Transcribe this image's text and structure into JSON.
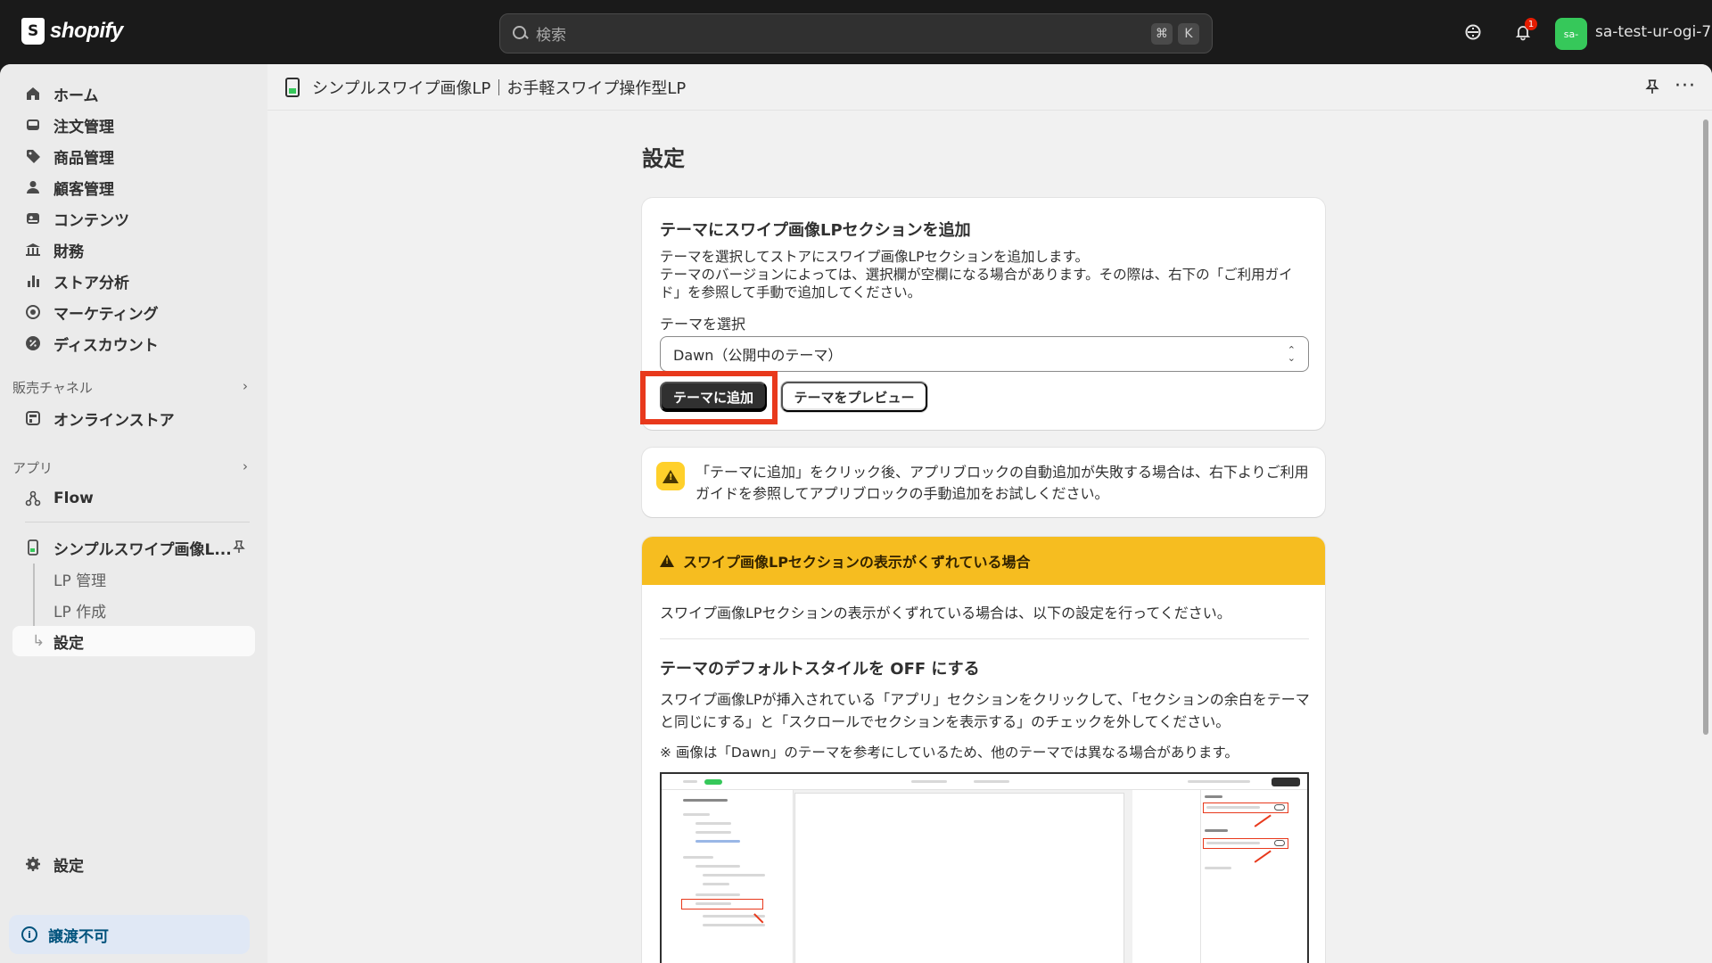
{
  "topbar": {
    "logo_text": "shopify",
    "search_placeholder": "検索",
    "shortcut_keys": [
      "⌘",
      "K"
    ],
    "notification_count": "1",
    "avatar_initials": "sa-",
    "store_name": "sa-test-ur-ogi-7"
  },
  "sidebar": {
    "items": [
      {
        "label": "ホーム",
        "icon": "home-icon"
      },
      {
        "label": "注文管理",
        "icon": "inbox-icon"
      },
      {
        "label": "商品管理",
        "icon": "tag-icon"
      },
      {
        "label": "顧客管理",
        "icon": "person-icon"
      },
      {
        "label": "コンテンツ",
        "icon": "content-icon"
      },
      {
        "label": "財務",
        "icon": "bank-icon"
      },
      {
        "label": "ストア分析",
        "icon": "chart-icon"
      },
      {
        "label": "マーケティング",
        "icon": "target-icon"
      },
      {
        "label": "ディスカウント",
        "icon": "discount-icon"
      }
    ],
    "sales_channels_label": "販売チャネル",
    "online_store_label": "オンラインストア",
    "apps_label": "アプリ",
    "flow_label": "Flow",
    "app_name": "シンプルスワイプ画像L...",
    "app_sub_items": [
      "LP 管理",
      "LP 作成",
      "設定"
    ],
    "settings_label": "設定",
    "notice_label": "譲渡不可"
  },
  "main": {
    "app_header_title": "シンプルスワイプ画像LP｜お手軽スワイプ操作型LP",
    "page_title": "設定",
    "card1": {
      "heading": "テーマにスワイプ画像LPセクションを追加",
      "desc_line1": "テーマを選択してストアにスワイプ画像LPセクションを追加します。",
      "desc_line2": "テーマのバージョンによっては、選択欄が空欄になる場合があります。その際は、右下の「ご利用ガイド」を参照して手動で追加してください。",
      "select_label": "テーマを選択",
      "select_value": "Dawn（公開中のテーマ）",
      "primary_button": "テーマに追加",
      "secondary_button": "テーマをプレビュー"
    },
    "card2": {
      "message": "「テーマに追加」をクリック後、アプリブロックの自動追加が失敗する場合は、右下よりご利用ガイドを参照してアプリブロックの手動追加をお試しください。"
    },
    "card3": {
      "header": "スワイプ画像LPセクションの表示がくずれている場合",
      "intro": "スワイプ画像LPセクションの表示がくずれている場合は、以下の設定を行ってください。",
      "subheading": "テーマのデフォルトスタイルを OFF にする",
      "paragraph": "スワイプ画像LPが挿入されている「アプリ」セクションをクリックして、「セクションの余白をテーマと同じにする」と「スクロールでセクションを表示する」のチェックを外してください。",
      "note": "※ 画像は「Dawn」のテーマを参考にしているため、他のテーマでは異なる場合があります。"
    }
  },
  "colors": {
    "topbar_bg": "#1a1a1a",
    "highlight": "#e8391c",
    "warning_header": "#f6bd20",
    "avatar_bg": "#36c85a"
  }
}
